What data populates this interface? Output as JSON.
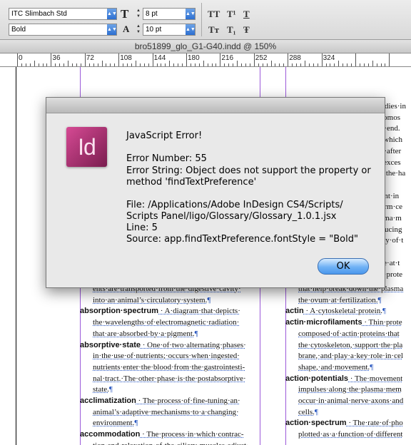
{
  "control_bar": {
    "font_family": "ITC Slimbach Std",
    "font_style": "Bold",
    "font_size": "8 pt",
    "leading": "10 pt",
    "caps_buttons": [
      "TT",
      "T¹",
      "T"
    ],
    "caps_buttons_row2": [
      "Tт",
      "T₁",
      "Ŧ"
    ]
  },
  "document_title": "bro51899_glo_G1-G40.indd @ 150%",
  "ruler": [
    "0",
    "36",
    "72",
    "108",
    "144",
    "180",
    "216",
    "252",
    "288",
    "324"
  ],
  "document": {
    "left_column": [
      {
        "term": "",
        "text": "ents·are·transported·from·the·digestive·cavity·",
        "indent": true
      },
      {
        "term": "",
        "text": "into·an·animal’s·circulatory·system.",
        "indent": true,
        "end": true
      },
      {
        "term": "absorption·spectrum",
        "text": " · A·diagram·that·depicts·",
        "indent": false
      },
      {
        "term": "",
        "text": "the·wavelengths·of·electromagnetic·radiation·",
        "indent": true
      },
      {
        "term": "",
        "text": "that·are·absorbed·by·a·pigment.",
        "indent": true,
        "end": true
      },
      {
        "term": "absorptive·state",
        "text": " · One·of·two·alternating·phases·",
        "indent": false
      },
      {
        "term": "",
        "text": "in·the·use·of·nutrients;·occurs·when·ingested·",
        "indent": true
      },
      {
        "term": "",
        "text": "nutrients·enter·the·blood·from·the·gastrointesti-",
        "indent": true
      },
      {
        "term": "",
        "text": "nal·tract.·The·other·phase·is·the·postabsorptive·",
        "indent": true
      },
      {
        "term": "",
        "text": "state.",
        "indent": true,
        "end": true
      },
      {
        "term": "acclimatization",
        "text": " · The·process·of·fine-tuning·an·",
        "indent": false
      },
      {
        "term": "",
        "text": "animal’s·adaptive·mechanisms·to·a·changing·",
        "indent": true
      },
      {
        "term": "",
        "text": "environment.",
        "indent": true,
        "end": true
      },
      {
        "term": "accommodation",
        "text": " · The·process·in·which·contrac-",
        "indent": false
      },
      {
        "term": "",
        "text": "tion·and·relaxation·of·the·ciliary·muscles·adjust·",
        "indent": true
      }
    ],
    "right_column_top": [
      "bodies·in",
      "hromos",
      "ne·end.",
      "n·which",
      "ed·after",
      "d·exces",
      "of·the·ha",
      "",
      "vent·in",
      "perm·ce",
      "asma·m",
      "oducing",
      "ntry·of·t",
      "",
      "ure·at·t",
      "ns·prote"
    ],
    "right_column": [
      {
        "term": "",
        "text": "that·help·break·down·the·plasma",
        "indent": true
      },
      {
        "term": "",
        "text": "the·ovum·at·fertilization.",
        "indent": true,
        "end": true
      },
      {
        "term": "actin",
        "text": " · A·cytoskeletal·protein.",
        "indent": false,
        "end": true
      },
      {
        "term": "actin·microfilaments",
        "text": " · Thin·prote",
        "indent": false
      },
      {
        "term": "",
        "text": "composed·of·actin·proteins·that",
        "indent": true
      },
      {
        "term": "",
        "text": "the·cytoskeleton,·support·the·pla",
        "indent": true
      },
      {
        "term": "",
        "text": "brane,·and·play·a·key·role·in·cel",
        "indent": true
      },
      {
        "term": "",
        "text": "shape,·and·movement.",
        "indent": true,
        "end": true
      },
      {
        "term": "action·potentials",
        "text": " · The·movement",
        "indent": false
      },
      {
        "term": "",
        "text": "impulses·along·the·plasma·mem",
        "indent": true
      },
      {
        "term": "",
        "text": "occur·in·animal·nerve·axons·and",
        "indent": true
      },
      {
        "term": "",
        "text": "cells.",
        "indent": true,
        "end": true
      },
      {
        "term": "action·spectrum",
        "text": " · The·rate·of·pho",
        "indent": false
      },
      {
        "term": "",
        "text": "plotted·as·a·function·of·different",
        "indent": true
      }
    ]
  },
  "dialog": {
    "app_icon_label": "Id",
    "lines": [
      "JavaScript Error!",
      "",
      "Error Number: 55",
      "Error String: Object does not support the property or",
      "method 'findTextPreference'",
      "",
      "File: /Applications/Adobe InDesign CS4/Scripts/",
      "Scripts Panel/ligo/Glossary/Glossary_1.0.1.jsx",
      "Line: 5",
      "Source: app.findTextPreference.fontStyle = \"Bold\""
    ],
    "ok_label": "OK"
  }
}
